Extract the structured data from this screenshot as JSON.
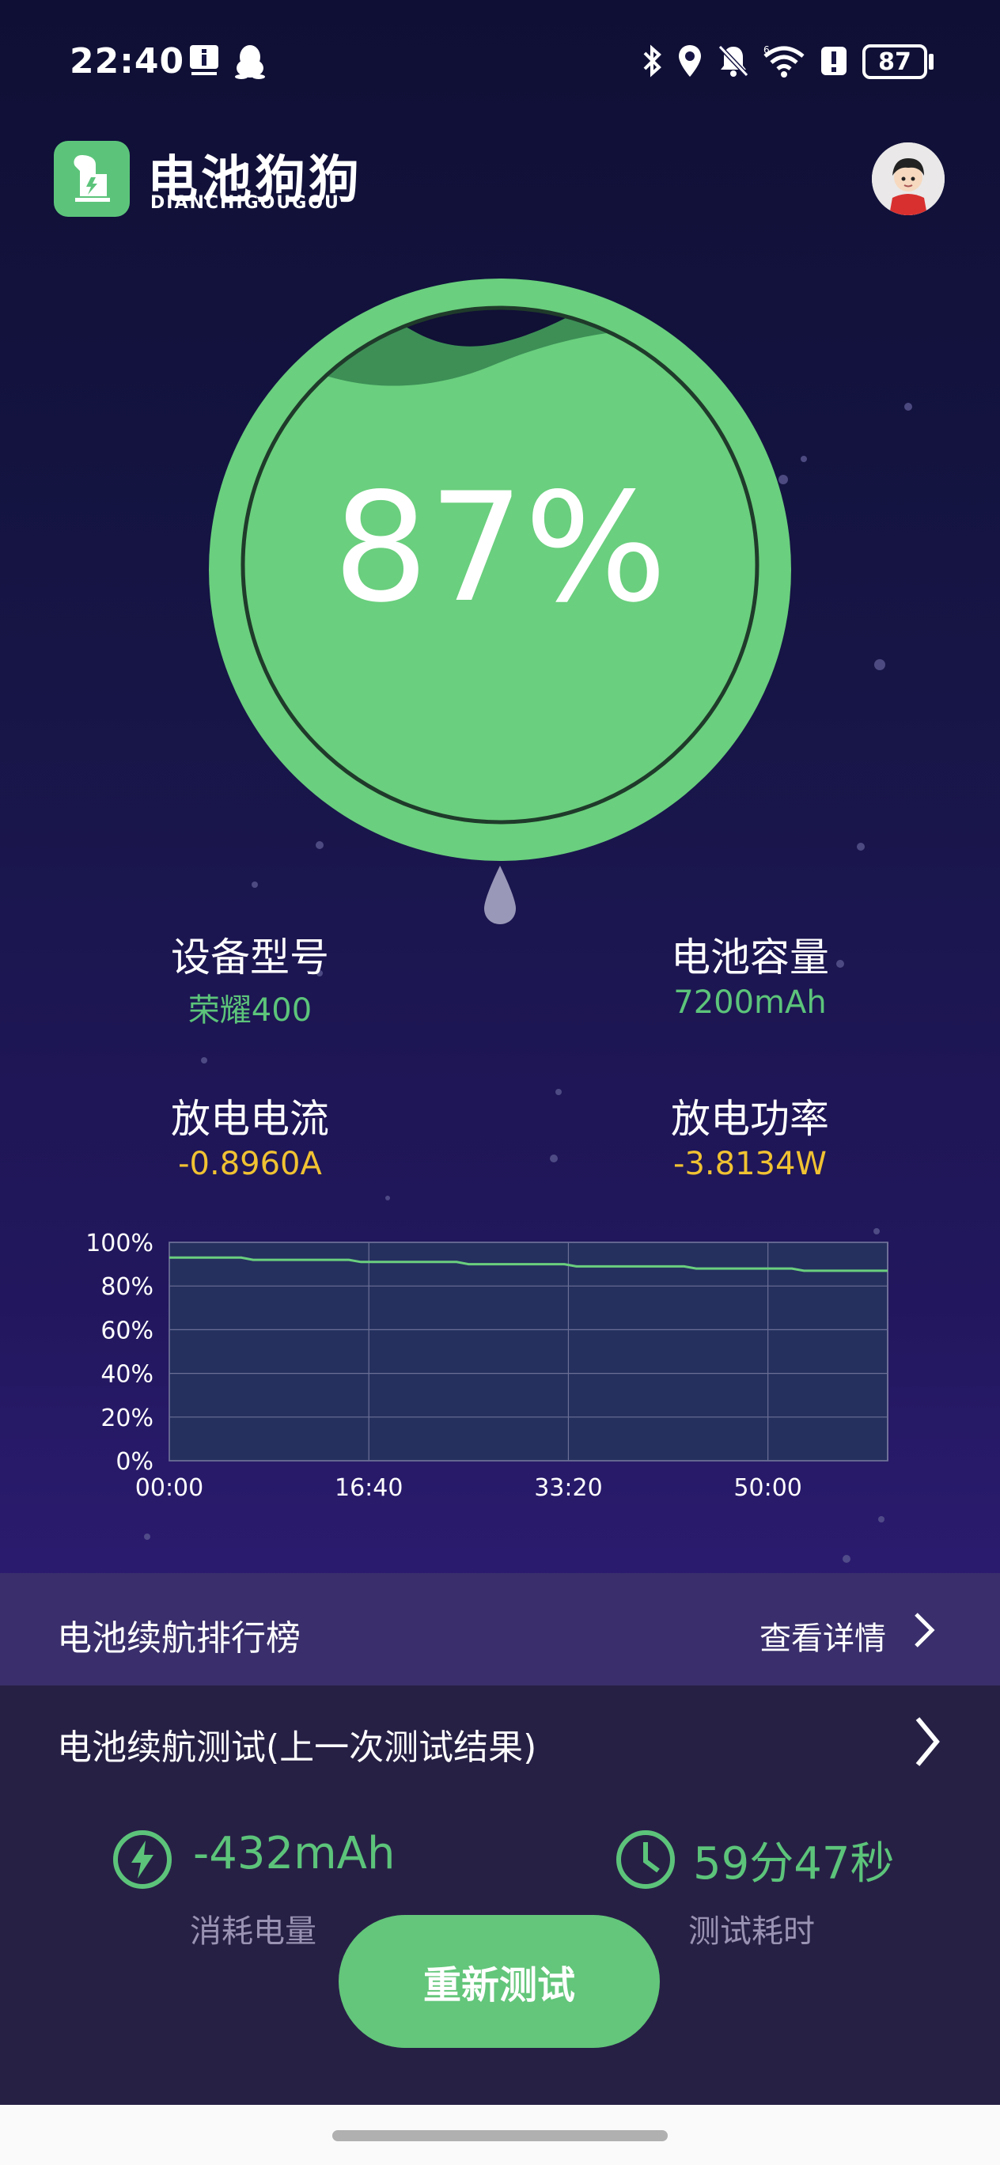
{
  "status_bar": {
    "time": "22:40",
    "battery_level": "87",
    "icons": [
      "info-notification-icon",
      "qq-penguin-icon",
      "bluetooth-icon",
      "location-icon",
      "mute-bell-icon",
      "wifi-icon",
      "alert-icon",
      "battery-icon"
    ]
  },
  "header": {
    "app_name": "电池狗狗",
    "app_name_latin": "DIANCHIGOUGOU",
    "avatar_icon": "user-avatar"
  },
  "gauge": {
    "percent_text": "87%",
    "level": 0.87,
    "fill_color": "#6acf7e"
  },
  "info": {
    "device_model_label": "设备型号",
    "device_model_value": "荣耀400",
    "capacity_label": "电池容量",
    "capacity_value": "7200mAh",
    "current_label": "放电电流",
    "current_value": "-0.8960A",
    "power_label": "放电功率",
    "power_value": "-3.8134W"
  },
  "chart_data": {
    "type": "line",
    "x_tick_labels": [
      "00:00",
      "16:40",
      "33:20",
      "50:00"
    ],
    "y_tick_labels": [
      "100%",
      "80%",
      "60%",
      "40%",
      "20%",
      "0%"
    ],
    "ylim": [
      0,
      100
    ],
    "xlim_minutes": [
      0,
      60
    ],
    "grid": true,
    "series": [
      {
        "x_minutes": [
          0,
          6,
          7,
          15,
          16,
          24,
          25,
          33,
          34,
          43,
          44,
          52,
          53,
          60
        ],
        "values": [
          93,
          93,
          92,
          92,
          91,
          91,
          90,
          90,
          89,
          89,
          88,
          88,
          87,
          87
        ],
        "color": "#6acf7e"
      }
    ]
  },
  "ranking": {
    "title": "电池续航排行榜",
    "link_label": "查看详情"
  },
  "last_test": {
    "title": "电池续航测试(上一次测试结果)",
    "consumed_value": "-432mAh",
    "consumed_label": "消耗电量",
    "duration_value": "59分47秒",
    "duration_label": "测试耗时",
    "retest_button": "重新测试"
  },
  "colors": {
    "accent_green": "#5cc47a",
    "warning_yellow": "#f1c232",
    "ranking_bar_bg": "#3a2f6c",
    "panel_bg": "#272045"
  }
}
